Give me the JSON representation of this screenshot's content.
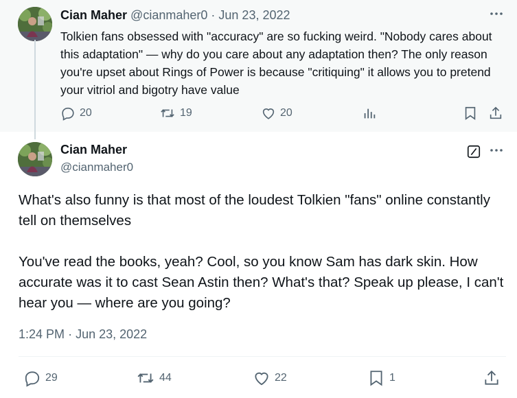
{
  "parent_tweet": {
    "name": "Cian Maher",
    "handle": "@cianmaher0",
    "separator": "·",
    "date": "Jun 23, 2022",
    "text": "Tolkien fans obsessed with \"accuracy\" are so fucking weird. \"Nobody cares about this adaptation\" — why do you care about any adaptation then? The only reason you're upset about Rings of Power is because \"critiquing\" it allows you to pretend your vitriol and bigotry have value",
    "replies": "20",
    "reposts": "19",
    "likes": "20"
  },
  "main_tweet": {
    "name": "Cian Maher",
    "handle": "@cianmaher0",
    "text": "What's also funny is that most of the loudest Tolkien \"fans\" online constantly tell on themselves\n\nYou've read the books, yeah? Cool, so you know Sam has dark skin. How accurate was it to cast Sean Astin then? What's that? Speak up please, I can't hear you — where are you going?",
    "time": "1:24 PM",
    "separator": "·",
    "date": "Jun 23, 2022",
    "replies": "29",
    "reposts": "44",
    "likes": "22",
    "bookmarks": "1"
  },
  "icons": {
    "more": "more-horizontal-icon",
    "reply": "reply-icon",
    "repost": "repost-icon",
    "like": "heart-icon",
    "views": "analytics-icon",
    "bookmark": "bookmark-icon",
    "share": "share-icon",
    "grok": "grok-icon"
  },
  "colors": {
    "text": "#0f1419",
    "muted": "#536471",
    "parent_background": "#f7f9f9",
    "divider": "#eff3f4"
  }
}
